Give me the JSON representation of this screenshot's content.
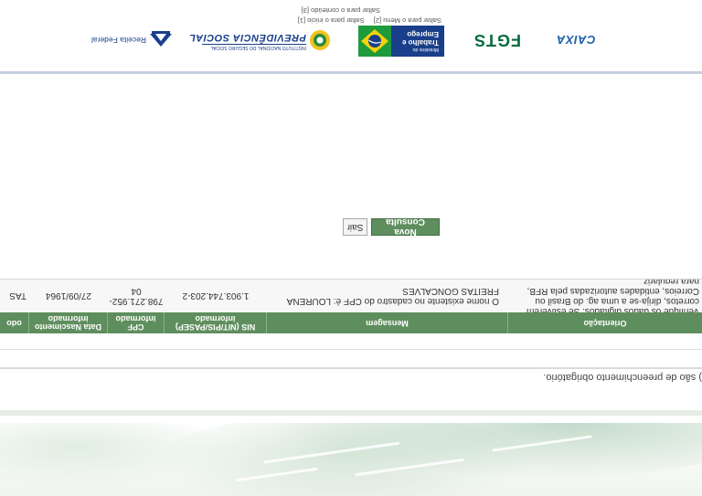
{
  "skip_links": {
    "inicio": "Saltar para o início [1]",
    "menu": "Saltar para o Menu [2]",
    "conteudo": "Saltar para o conteúdo [3]"
  },
  "logos": {
    "caixa": "CAIXA",
    "fgts": "FGTS",
    "mte_line1": "Ministério do",
    "mte_line2": "Trabalho e",
    "mte_line3": "Emprego",
    "previdencia": "PREVIDÊNCIA SOCIAL",
    "previdencia_sub": "INSTITUTO NACIONAL DO SEGURO SOCIAL",
    "receita": "Receita Federal"
  },
  "buttons": {
    "nova_consulta": "Nova Consulta",
    "sair": "Sair"
  },
  "table": {
    "headers": {
      "col0": "odo",
      "data_nascimento": "Data Nascimento informado",
      "cpf": "CPF informado",
      "nis": "NIS (NIT/PIS/PASEP) informado",
      "mensagem": "Mensagem",
      "orientacao": "Orientação"
    },
    "row": {
      "col0": "TAS",
      "data_nascimento": "27/09/1964",
      "cpf": "798.271.952-04",
      "nis": "1.903.744.203-2",
      "mensagem": "O nome existente no cadastro do CPF é: LOURENA FREITAS GONCALVES",
      "orientacao": "Verifique os dados digitados. Se estiverem corretos, dirija-se a uma ag. do Brasil ou Correios, entidades autorizadas pela RFB, para regulariz"
    }
  },
  "required_note": ") são de preenchimento obrigatório."
}
